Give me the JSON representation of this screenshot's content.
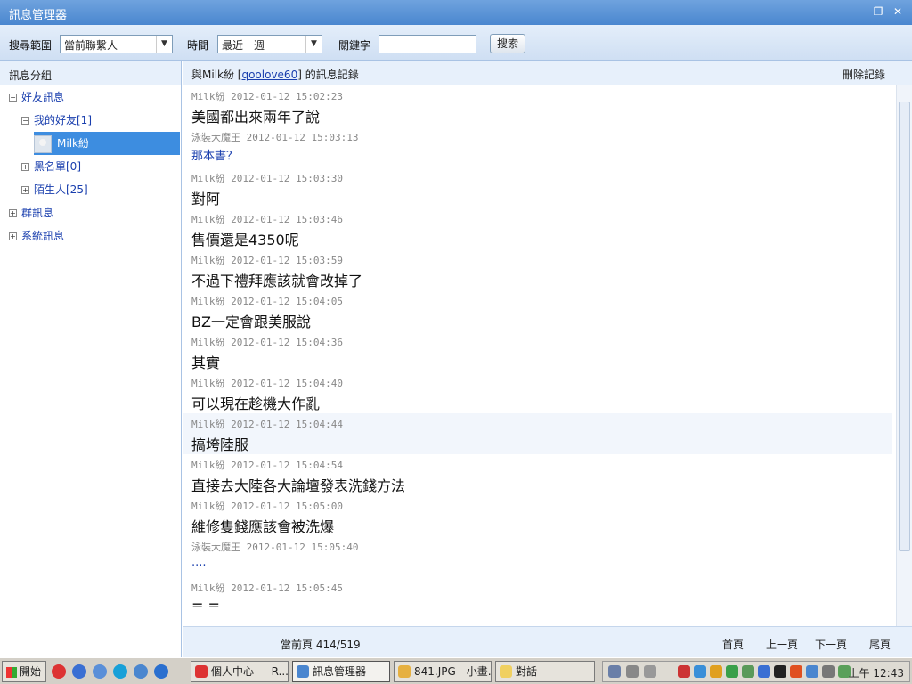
{
  "window": {
    "title": "訊息管理器",
    "minimize": "—",
    "restore": "❐",
    "close": "✕"
  },
  "search": {
    "range_label": "搜尋範圍",
    "range_value": "當前聯繫人",
    "time_label": "時間",
    "time_value": "最近一週",
    "keyword_label": "關鍵字",
    "keyword_value": "",
    "button_label": "搜索"
  },
  "sidebar": {
    "header": "訊息分組",
    "tree": [
      {
        "label": "好友訊息",
        "toggle": "−"
      },
      {
        "label": "我的好友[1]",
        "toggle": "−"
      },
      {
        "label": "Milk紛"
      },
      {
        "label": "黑名單[0]",
        "toggle": "+"
      },
      {
        "label": "陌生人[25]",
        "toggle": "+"
      },
      {
        "label": "群訊息",
        "toggle": "+"
      },
      {
        "label": "系統訊息",
        "toggle": "+"
      }
    ]
  },
  "conversation": {
    "header_prefix": "與Milk紛 [",
    "header_link": "qoolove60",
    "header_suffix": "] 的訊息記錄",
    "delete_label": "刪除記錄",
    "messages": [
      {
        "meta": "Milk紛 2012-01-12 15:02:23",
        "text": "美國都出來兩年了說"
      },
      {
        "meta": "泳裝大魔王 2012-01-12 15:03:13",
        "text": "那本書？"
      },
      {
        "meta": "Milk紛 2012-01-12 15:03:30",
        "text": "對阿"
      },
      {
        "meta": "Milk紛 2012-01-12 15:03:46",
        "text": "售價還是4350呢"
      },
      {
        "meta": "Milk紛 2012-01-12 15:03:59",
        "text": "不過下禮拜應該就會改掉了"
      },
      {
        "meta": "Milk紛 2012-01-12 15:04:05",
        "text": "BZ一定會跟美服說"
      },
      {
        "meta": "Milk紛 2012-01-12 15:04:36",
        "text": "其實"
      },
      {
        "meta": "Milk紛 2012-01-12 15:04:40",
        "text": "可以現在趁機大作亂"
      },
      {
        "meta": "Milk紛 2012-01-12 15:04:44",
        "text": "搞垮陸服"
      },
      {
        "meta": "Milk紛 2012-01-12 15:04:54",
        "text": "直接去大陸各大論壇發表洗錢方法"
      },
      {
        "meta": "Milk紛 2012-01-12 15:05:00",
        "text": "維修隻錢應該會被洗爆"
      },
      {
        "meta": "泳裝大魔王 2012-01-12 15:05:40",
        "text": "...."
      },
      {
        "meta": "Milk紛 2012-01-12 15:05:45",
        "text": "= ="
      }
    ]
  },
  "pager": {
    "current_page": "當前頁 414/519",
    "first": "首頁",
    "prev": "上一頁",
    "next": "下一頁",
    "last": "尾頁"
  },
  "taskbar": {
    "start_label": "開始",
    "tasks": [
      {
        "label": "個人中心 — R..."
      },
      {
        "label": "訊息管理器"
      },
      {
        "label": "841.JPG - 小畫..."
      },
      {
        "label": "對話"
      }
    ],
    "clock": "上午 12:43"
  },
  "colors": {
    "accent": "#3d8de0",
    "titlebar": "#4a86cf",
    "link": "#1a3fae"
  }
}
